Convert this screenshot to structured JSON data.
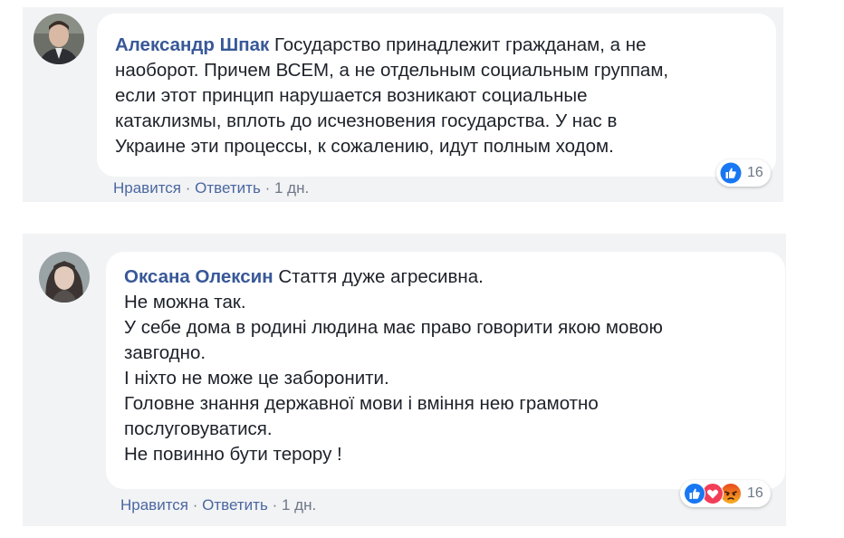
{
  "comments": [
    {
      "author": "Александр Шпак",
      "lines": [
        "Государство принадлежит гражданам, а не",
        "наоборот. Причем ВСЕМ, а не отдельным социальным группам,",
        "если этот принцип нарушается возникают социальные",
        "катаклизмы, вплоть до исчезновения государства. У нас в",
        "Украине эти процессы, к сожалению, идут полным ходом."
      ],
      "like_label": "Нравится",
      "reply_label": "Ответить",
      "time": "1 дн.",
      "reaction_icons": [
        "like-icon"
      ],
      "reaction_count": "16"
    },
    {
      "author": "Оксана Олексин",
      "lines": [
        "Стаття дуже агресивна.",
        "Не можна так.",
        "У себе дома в родині людина має право говорити якою мовою",
        "завгодно.",
        "І ніхто не може це заборонити.",
        "Головне знання державної мови і вміння нею грамотно",
        "послуговуватися.",
        "Не повинно бути терору !"
      ],
      "like_label": "Нравится",
      "reply_label": "Ответить",
      "time": "1 дн.",
      "reaction_icons": [
        "like-icon",
        "love-icon",
        "angry-icon"
      ],
      "reaction_count": "16"
    }
  ],
  "separator": "·",
  "colors": {
    "author": "#385898",
    "panel": "#f2f3f5",
    "like": "#1877f2",
    "love": "#f33e58",
    "angry": "#e9710f"
  }
}
